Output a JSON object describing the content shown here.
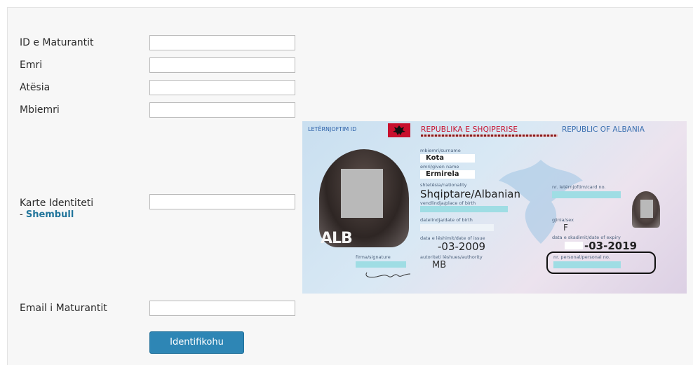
{
  "form": {
    "fields": [
      {
        "label": "ID e Maturantit",
        "value": ""
      },
      {
        "label": "Emri",
        "value": ""
      },
      {
        "label": "Atësia",
        "value": ""
      },
      {
        "label": "Mbiemri",
        "value": ""
      }
    ],
    "id_card": {
      "label": "Karte Identiteti",
      "link_prefix": "- ",
      "link": "Shembull",
      "value": ""
    },
    "email": {
      "label": "Email i Maturantit",
      "value": ""
    },
    "submit_label": "Identifikohu"
  },
  "card": {
    "header_left": "LETËRNJOFTIM ID",
    "header_sq": "REPUBLIKA E SHQIPERISE",
    "header_en": "REPUBLIC OF ALBANIA",
    "surname_lbl": "mbiemri/surname",
    "surname": "Kota",
    "given_lbl": "emri/given name",
    "given": "Ermirela",
    "nat_lbl": "shtetësia/nationality",
    "nationality": "Shqiptare/Albanian",
    "place_lbl": "vendlindja/place of birth",
    "card_no_lbl": "nr. letërnjoftim/card no.",
    "dob_lbl": "datelindja/date of birth",
    "sex_lbl": "gjinia/sex",
    "sex": "F",
    "issue_lbl": "data e lëshimit/date of issue",
    "issue": "-03-2009",
    "expiry_lbl": "data e skadimit/date of expiry",
    "expiry": "-03-2019",
    "sig_lbl": "firma/signature",
    "auth_lbl": "autoriteti lëshues/authority",
    "authority": "MB",
    "personal_lbl": "nr. personal/personal no.",
    "country_code": "ALB"
  },
  "colors": {
    "button": "#2e86b5",
    "link": "#21759b",
    "card_header_red": "#c8102e"
  }
}
